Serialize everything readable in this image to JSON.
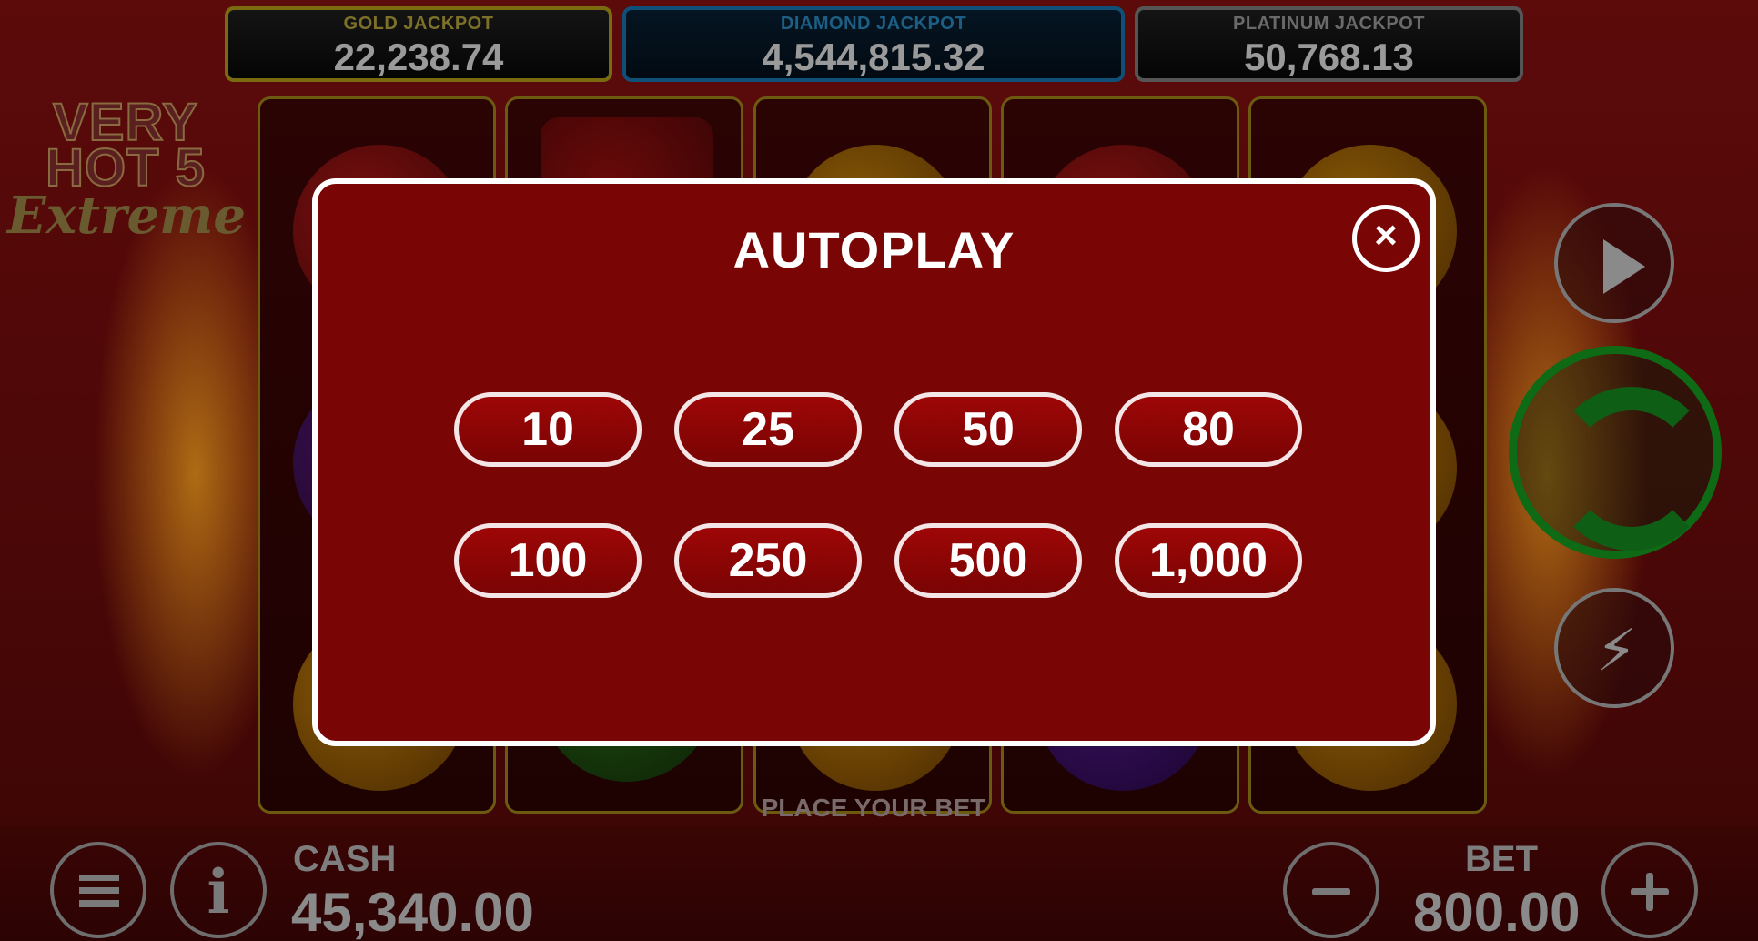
{
  "jackpots": {
    "gold": {
      "label": "GOLD JACKPOT",
      "value": "22,238.74"
    },
    "diamond": {
      "label": "DIAMOND JACKPOT",
      "value": "4,544,815.32"
    },
    "platinum": {
      "label": "PLATINUM JACKPOT",
      "value": "50,768.13"
    }
  },
  "logo": {
    "line1": "VERY",
    "line2": "HOT 5",
    "line3": "Extreme"
  },
  "status": {
    "message": "PLACE YOUR BET"
  },
  "cash": {
    "label": "CASH",
    "value": "45,340.00"
  },
  "bet": {
    "label": "BET",
    "value": "800.00"
  },
  "autoplay": {
    "title": "AUTOPLAY",
    "close_glyph": "×",
    "options": [
      "10",
      "25",
      "50",
      "80",
      "100",
      "250",
      "500",
      "1,000"
    ]
  },
  "icons": {
    "info": "i",
    "turbo": "⚡"
  },
  "colors": {
    "dialog_bg": "#7a0505",
    "option_bg": "#9e0606",
    "spin_ring": "#0f6a16"
  }
}
